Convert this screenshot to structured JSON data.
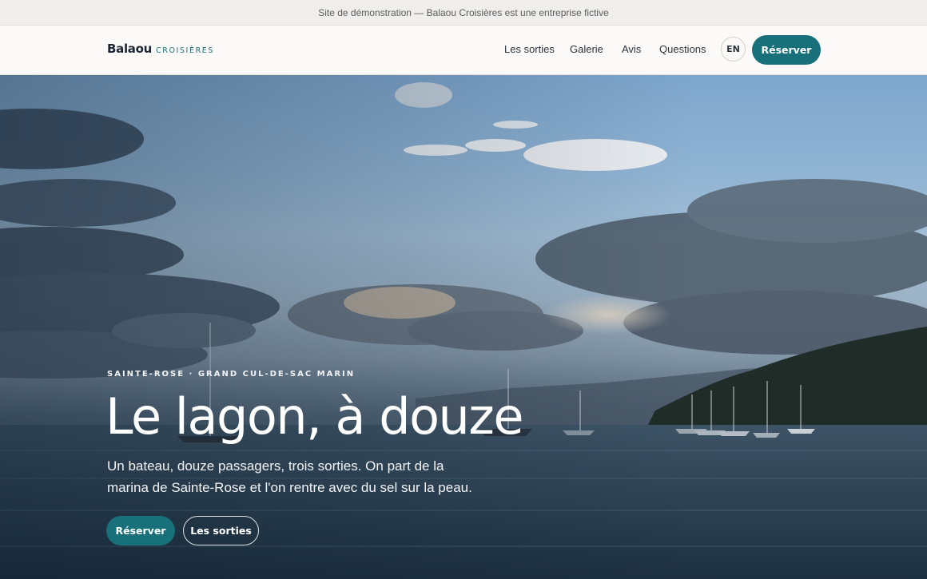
{
  "banner": {
    "text": "Site de démonstration — Balaou Croisières est une entreprise fictive"
  },
  "brand": {
    "name": "Balaou",
    "tagline": "CROISIÈRES"
  },
  "nav": {
    "links": [
      {
        "label": "Les sorties"
      },
      {
        "label": "Galerie"
      },
      {
        "label": "Avis"
      },
      {
        "label": "Questions"
      }
    ],
    "lang_label": "EN",
    "cta_label": "Réserver"
  },
  "hero": {
    "eyebrow": "SAINTE-ROSE · GRAND CUL-DE-SAC MARIN",
    "title": "Le lagon, à douze",
    "lede": "Un bateau, douze passagers, trois sorties. On part de la marina de Sainte-Rose et l'on rentre avec du sel sur la peau.",
    "primary_cta": "Réserver",
    "secondary_cta": "Les sorties"
  },
  "colors": {
    "accent": "#17707a",
    "banner_bg": "#efeeec",
    "nav_bg": "#fbfaf8",
    "text_dark": "#2b333b"
  }
}
